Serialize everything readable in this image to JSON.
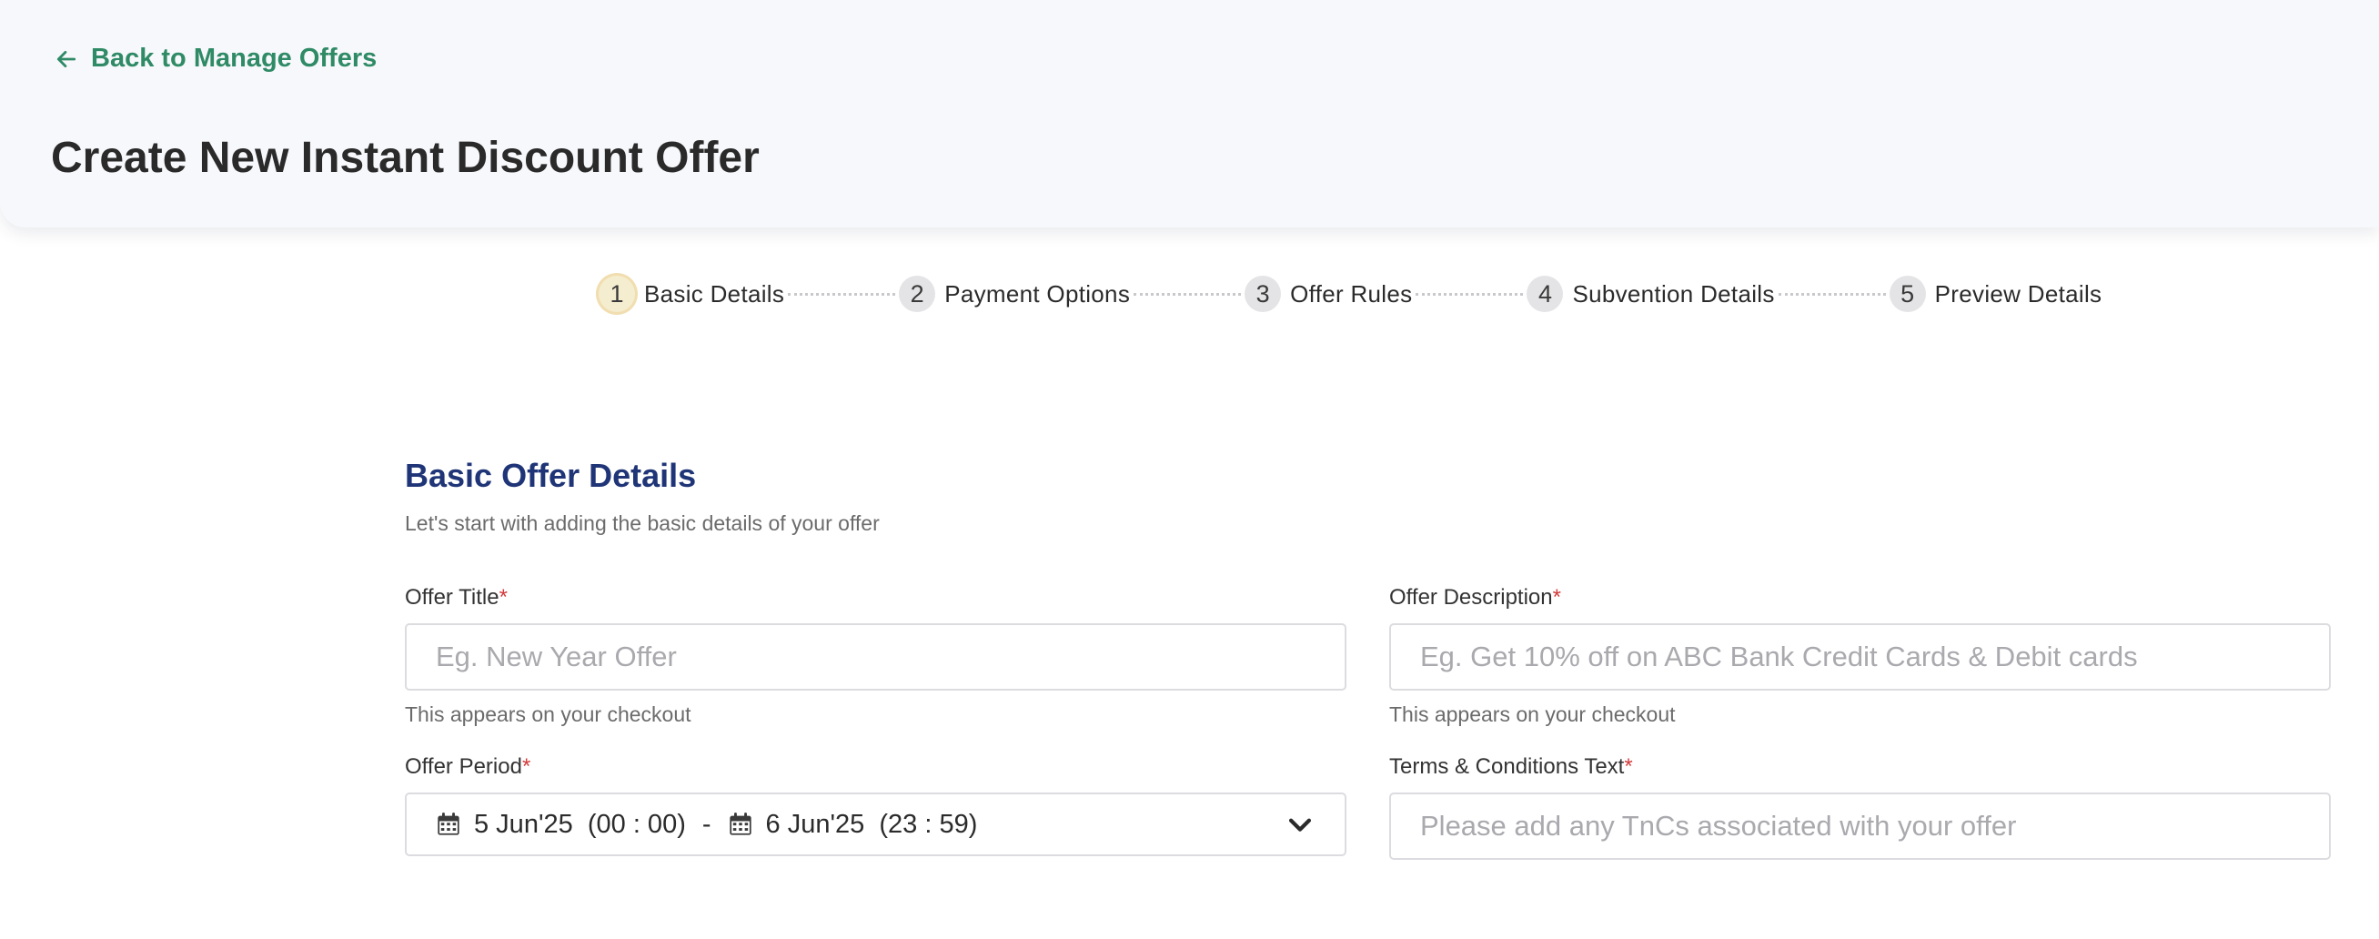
{
  "header": {
    "back_label": "Back to Manage Offers",
    "title": "Create New Instant Discount Offer"
  },
  "stepper": {
    "steps": [
      {
        "number": "1",
        "label": "Basic Details",
        "active": true
      },
      {
        "number": "2",
        "label": "Payment Options",
        "active": false
      },
      {
        "number": "3",
        "label": "Offer Rules",
        "active": false
      },
      {
        "number": "4",
        "label": "Subvention Details",
        "active": false
      },
      {
        "number": "5",
        "label": "Preview Details",
        "active": false
      }
    ]
  },
  "section": {
    "title": "Basic Offer Details",
    "subtitle": "Let's start with adding the basic details of your offer"
  },
  "form": {
    "required_mark": "*",
    "offer_title": {
      "label": "Offer Title",
      "value": "",
      "placeholder": "Eg. New Year Offer",
      "helper": "This appears on your checkout"
    },
    "offer_description": {
      "label": "Offer Description",
      "value": "",
      "placeholder": "Eg. Get 10% off on ABC Bank Credit Cards & Debit cards",
      "helper": "This appears on your checkout"
    },
    "offer_period": {
      "label": "Offer Period",
      "start": "5 Jun'25  (00 : 00)",
      "separator": "-",
      "end": "6 Jun'25  (23 : 59)"
    },
    "terms": {
      "label": "Terms & Conditions Text",
      "value": "",
      "placeholder": "Please add any TnCs associated with your offer"
    }
  },
  "icons": {
    "back": "arrow-left-icon",
    "calendar": "calendar-icon",
    "dropdown": "chevron-down-icon"
  },
  "colors": {
    "accent_green": "#2f8a66",
    "section_title": "#1f3577",
    "required": "#d23b3b",
    "active_step": "#f5edcf"
  }
}
